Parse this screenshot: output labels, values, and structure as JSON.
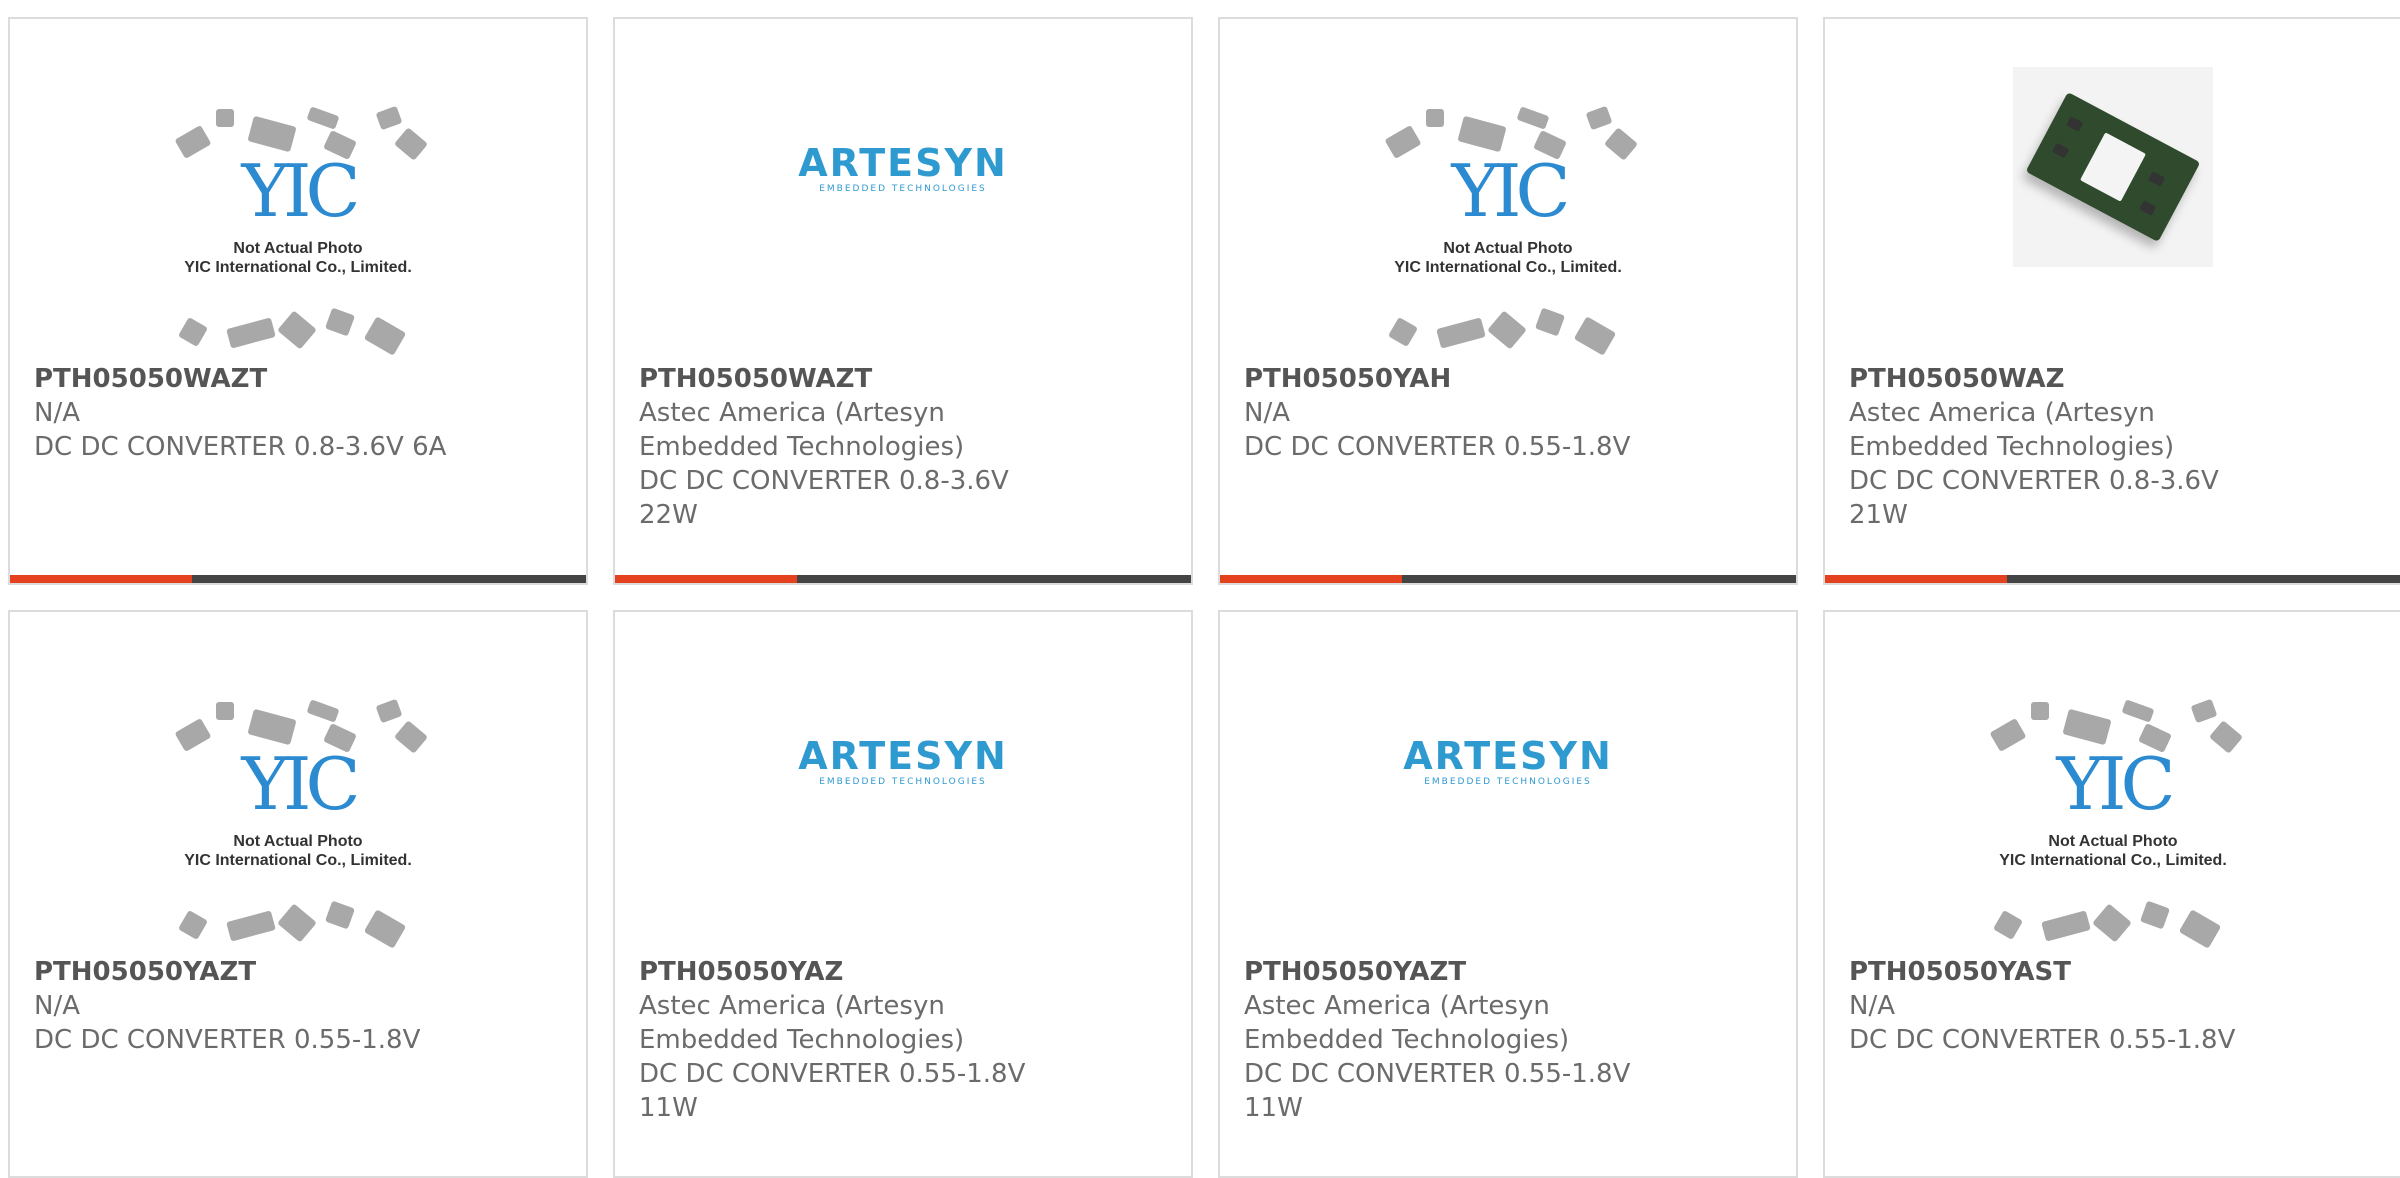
{
  "products": [
    {
      "part": "PTH05050WAZT",
      "manufacturer": "N/A",
      "description": "DC DC CONVERTER 0.8-3.6V 6A",
      "image": "yic-placeholder",
      "image_caption": "Not Actual Photo\nYIC International Co., Limited."
    },
    {
      "part": "PTH05050WAZT",
      "manufacturer": "Astec America (Artesyn Embedded Technologies)",
      "description": "DC DC CONVERTER 0.8-3.6V 22W",
      "image": "artesyn-logo"
    },
    {
      "part": "PTH05050YAH",
      "manufacturer": "N/A",
      "description": "DC DC CONVERTER 0.55-1.8V",
      "image": "yic-placeholder",
      "image_caption": "Not Actual Photo\nYIC International Co., Limited."
    },
    {
      "part": "PTH05050WAZ",
      "manufacturer": "Astec America (Artesyn Embedded Technologies)",
      "description": "DC DC CONVERTER 0.8-3.6V 21W",
      "image": "module-photo"
    },
    {
      "part": "PTH05050YAZT",
      "manufacturer": "N/A",
      "description": "DC DC CONVERTER 0.55-1.8V",
      "image": "yic-placeholder",
      "image_caption": "Not Actual Photo\nYIC International Co., Limited."
    },
    {
      "part": "PTH05050YAZ",
      "manufacturer": "Astec America (Artesyn Embedded Technologies)",
      "description": "DC DC CONVERTER 0.55-1.8V 11W",
      "image": "artesyn-logo"
    },
    {
      "part": "PTH05050YAZT",
      "manufacturer": "Astec America (Artesyn Embedded Technologies)",
      "description": "DC DC CONVERTER 0.55-1.8V 11W",
      "image": "artesyn-logo"
    },
    {
      "part": "PTH05050YAST",
      "manufacturer": "N/A",
      "description": "DC DC CONVERTER 0.55-1.8V",
      "image": "yic-placeholder",
      "image_caption": "Not Actual Photo\nYIC International Co., Limited."
    }
  ],
  "logos": {
    "yic_text": "YIC",
    "artesyn_word": "ARTESYN",
    "artesyn_sub": "EMBEDDED TECHNOLOGIES"
  },
  "colors": {
    "accent": "#e4421f",
    "bar": "#444444",
    "text": "#6b6b6b",
    "yic_blue": "#2b8ad0",
    "artesyn_blue": "#2f9ad0"
  }
}
